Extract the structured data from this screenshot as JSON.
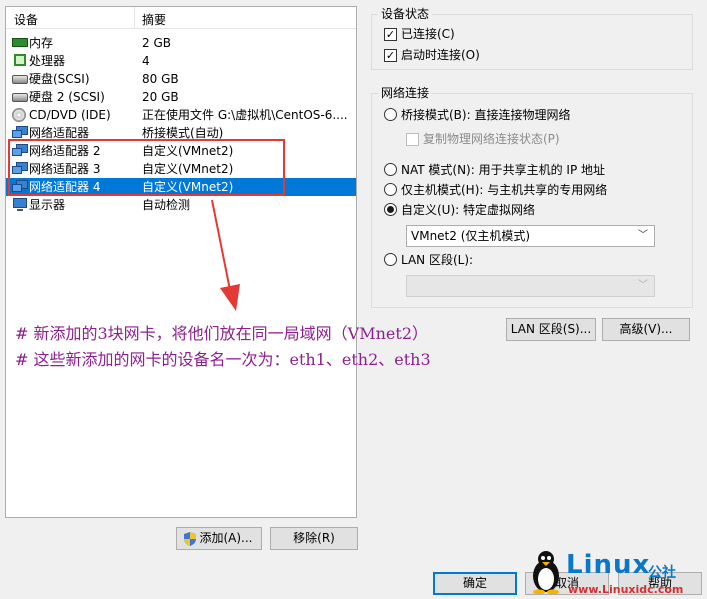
{
  "device_list": {
    "headers": {
      "device": "设备",
      "summary": "摘要"
    },
    "rows": [
      {
        "name": "内存",
        "summary": "2 GB",
        "icon": "memory-icon"
      },
      {
        "name": "处理器",
        "summary": "4",
        "icon": "cpu-icon"
      },
      {
        "name": "硬盘(SCSI)",
        "summary": "80 GB",
        "icon": "hard-disk-icon"
      },
      {
        "name": "硬盘 2 (SCSI)",
        "summary": "20 GB",
        "icon": "hard-disk-icon"
      },
      {
        "name": "CD/DVD (IDE)",
        "summary": "正在使用文件 G:\\虚拟机\\CentOS-6....",
        "icon": "cd-dvd-icon"
      },
      {
        "name": "网络适配器",
        "summary": "桥接模式(自动)",
        "icon": "network-adapter-icon"
      },
      {
        "name": "网络适配器 2",
        "summary": "自定义(VMnet2)",
        "icon": "network-adapter-icon"
      },
      {
        "name": "网络适配器 3",
        "summary": "自定义(VMnet2)",
        "icon": "network-adapter-icon"
      },
      {
        "name": "网络适配器 4",
        "summary": "自定义(VMnet2)",
        "icon": "network-adapter-icon",
        "selected": true
      },
      {
        "name": "显示器",
        "summary": "自动检测",
        "icon": "display-icon"
      }
    ]
  },
  "annotation": {
    "line1": "# 新添加的3块网卡，将他们放在同一局域网（VMnet2）",
    "line2": "# 这些新添加的网卡的设备名一次为：eth1、eth2、eth3",
    "highlight_color": "#e53935",
    "text_color": "#8e1f8e"
  },
  "buttons": {
    "add": "添加(A)...",
    "remove": "移除(R)",
    "ok": "确定",
    "cancel": "取消",
    "help": "帮助",
    "lan_segments": "LAN 区段(S)...",
    "advanced": "高级(V)..."
  },
  "device_status": {
    "title": "设备状态",
    "connected": {
      "label": "已连接(C)",
      "checked": true
    },
    "connect_at_power_on": {
      "label": "启动时连接(O)",
      "checked": true
    }
  },
  "network_connection": {
    "title": "网络连接",
    "bridged": "桥接模式(B): 直接连接物理网络",
    "replicate": "复制物理网络连接状态(P)",
    "nat": "NAT 模式(N): 用于共享主机的 IP 地址",
    "host_only": "仅主机模式(H): 与主机共享的专用网络",
    "custom": "自定义(U): 特定虚拟网络",
    "custom_selected": true,
    "vmnet_value": "VMnet2 (仅主机模式)",
    "lan_segment": "LAN 区段(L):",
    "lan_value": ""
  },
  "watermark": {
    "brand": "Linux",
    "cn": "公社",
    "url": "www.Linuxidc.com"
  },
  "colors": {
    "selection": "#0078d7",
    "brand_blue": "#0a78c8",
    "brand_red": "#d32f2f"
  }
}
